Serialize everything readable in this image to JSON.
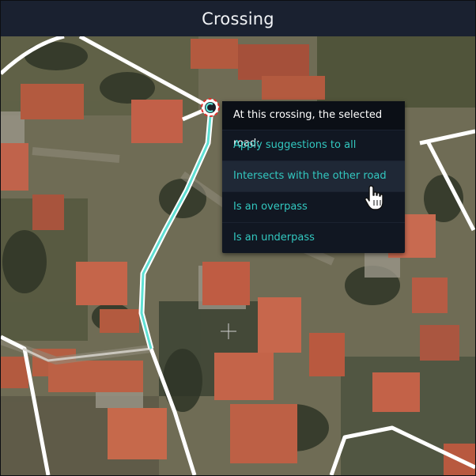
{
  "title": "Crossing",
  "menu": {
    "header": "At this crossing, the selected road:",
    "items": [
      {
        "label": "Apply suggestions to all"
      },
      {
        "label": "Intersects with the other road"
      },
      {
        "label": "Is an overpass"
      },
      {
        "label": "Is an underpass"
      }
    ],
    "hovered_index": 1
  },
  "colors": {
    "title_bg": "#1a2130",
    "menu_bg": "#111722",
    "menu_item_text": "#32c8c0",
    "selected_road": "#5fe0d4",
    "road": "#ffffff",
    "crossing_marker": "#e0302b"
  },
  "icons": {
    "cursor": "hand-pointer-icon",
    "crossing": "crossing-marker-icon",
    "crosshair": "map-crosshair-icon"
  }
}
